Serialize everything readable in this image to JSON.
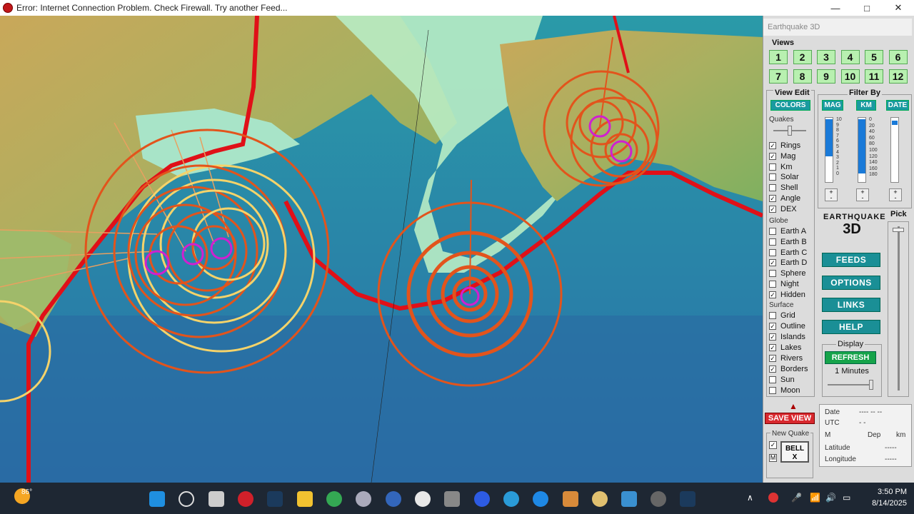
{
  "window": {
    "title": "Error: Internet Connection Problem. Check Firewall. Try another Feed...",
    "minimize": "—",
    "maximize": "□",
    "close": "✕"
  },
  "panel": {
    "app_title": "Earthquake 3D",
    "views_label": "Views",
    "view_buttons": [
      "1",
      "2",
      "3",
      "4",
      "5",
      "6",
      "7",
      "8",
      "9",
      "10",
      "11",
      "12"
    ],
    "view_edit_label": "View Edit",
    "colors_button": "COLORS",
    "quakes_label": "Quakes",
    "filter_by_label": "Filter By",
    "filter_buttons": [
      "MAG",
      "KM",
      "DATE"
    ],
    "mag_scale": [
      "10",
      "9",
      "8",
      "7",
      "6",
      "5",
      "4",
      "3",
      "2",
      "1",
      "0"
    ],
    "km_scale": [
      "0",
      "20",
      "40",
      "60",
      "80",
      "100",
      "120",
      "140",
      "160",
      "180"
    ],
    "quake_options": [
      {
        "label": "Rings",
        "checked": true
      },
      {
        "label": "Mag",
        "checked": true
      },
      {
        "label": "Km",
        "checked": false
      },
      {
        "label": "Solar",
        "checked": false
      },
      {
        "label": "Shell",
        "checked": false
      },
      {
        "label": "Angle",
        "checked": true
      },
      {
        "label": "DEX",
        "checked": true
      }
    ],
    "globe_label": "Globe",
    "globe_options": [
      {
        "label": "Earth A",
        "checked": false
      },
      {
        "label": "Earth B",
        "checked": false
      },
      {
        "label": "Earth C",
        "checked": false
      },
      {
        "label": "Earth D",
        "checked": true
      },
      {
        "label": "Sphere",
        "checked": false
      },
      {
        "label": "Night",
        "checked": false
      },
      {
        "label": "Hidden",
        "checked": true
      }
    ],
    "surface_label": "Surface",
    "surface_options": [
      {
        "label": "Grid",
        "checked": false
      },
      {
        "label": "Outline",
        "checked": true
      },
      {
        "label": "Islands",
        "checked": true
      },
      {
        "label": "Lakes",
        "checked": true
      },
      {
        "label": "Rivers",
        "checked": true
      },
      {
        "label": "Borders",
        "checked": true
      },
      {
        "label": "Sun",
        "checked": false
      },
      {
        "label": "Moon",
        "checked": false
      }
    ],
    "pick_label": "Pick",
    "logo_text": "EARTHQUAKE",
    "logo_sub": "3D",
    "feeds_button": "FEEDS",
    "options_button": "OPTIONS",
    "links_button": "LINKS",
    "help_button": "HELP",
    "display_label": "Display",
    "refresh_button": "REFRESH",
    "refresh_interval": "1 Minutes",
    "save_view_button": "SAVE VIEW",
    "new_quake_label": "New Quake",
    "bell_button": "BELL",
    "bell_x": "X",
    "m_label": "M",
    "info": {
      "date_label": "Date",
      "date_value": "---- -- --",
      "utc_label": "UTC",
      "utc_value": "-   -",
      "m_label": "M",
      "dep_label": "Dep",
      "km_label": "km",
      "latitude_label": "Latitude",
      "latitude_value": "-----",
      "longitude_label": "Longitude",
      "longitude_value": "-----"
    }
  },
  "taskbar": {
    "weather_temp": "86°",
    "time": "3:50 PM",
    "date": "8/14/2025",
    "up_arrow": "∧"
  },
  "colors": {
    "accent_teal": "#1a9aa0",
    "save_red": "#d8282e",
    "ring_orange": "#e2541c",
    "ring_yellow": "#f5d36a",
    "plate_red": "#e01018"
  }
}
